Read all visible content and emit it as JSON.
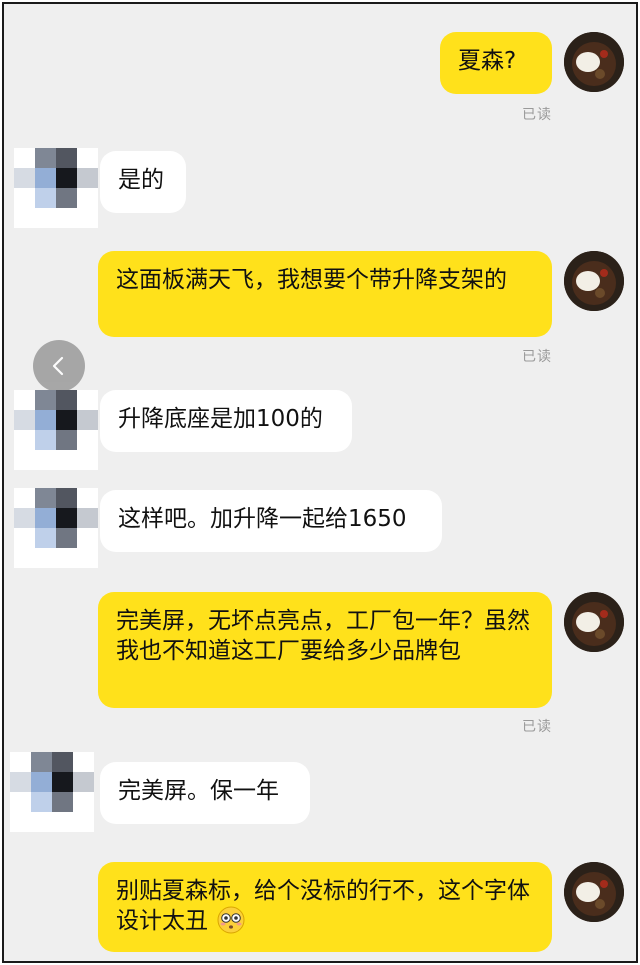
{
  "messages": [
    {
      "side": "me",
      "text": "夏森?",
      "read_label": "已读"
    },
    {
      "side": "other",
      "text": "是的"
    },
    {
      "side": "me",
      "text": "这面板满天飞，我想要个带升降支架的",
      "read_label": "已读"
    },
    {
      "side": "other",
      "text": "升降底座是加100的"
    },
    {
      "side": "other",
      "text": "这样吧。加升降一起给1650"
    },
    {
      "side": "me",
      "text": "完美屏，无坏点亮点，工厂包一年？虽然我也不知道这工厂要给多少品牌包",
      "read_label": "已读"
    },
    {
      "side": "other",
      "text": "完美屏。保一年"
    },
    {
      "side": "me",
      "text": "别贴夏森标，给个没标的行不，这个字体设计太丑",
      "emoji": "flushed-face-emoji"
    }
  ],
  "icons": {
    "back": "chevron-left-icon",
    "my_avatar": "food-photo-avatar",
    "other_avatar": "pixelated-avatar"
  },
  "colors": {
    "my_bubble": "#ffe11b",
    "other_bubble": "#ffffff",
    "background": "#efefef",
    "read_label": "#9a9a9a"
  }
}
